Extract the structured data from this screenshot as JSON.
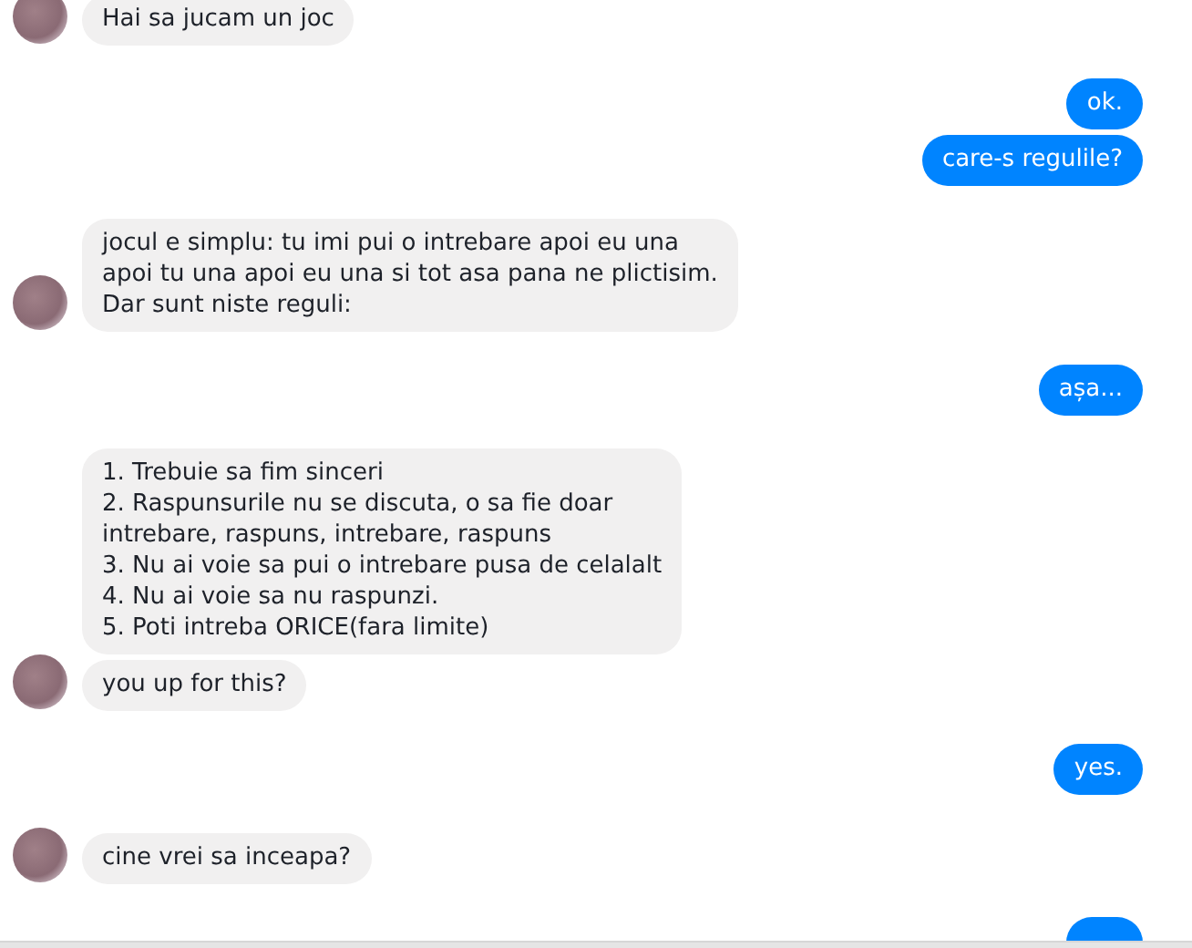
{
  "conversation": [
    {
      "outgoing": false,
      "messages": [
        {
          "kind": "text",
          "text": "Hai sa jucam un joc"
        }
      ]
    },
    {
      "outgoing": true,
      "messages": [
        {
          "kind": "text",
          "text": "ok."
        },
        {
          "kind": "text",
          "text": "care-s regulile?"
        }
      ]
    },
    {
      "outgoing": false,
      "messages": [
        {
          "kind": "text",
          "text": "jocul e simplu: tu imi pui o intrebare apoi eu una\napoi tu una apoi eu una si tot asa pana ne plictisim.\nDar sunt niste reguli:"
        }
      ]
    },
    {
      "outgoing": true,
      "messages": [
        {
          "kind": "text",
          "text": "așa..."
        }
      ]
    },
    {
      "outgoing": false,
      "messages": [
        {
          "kind": "text",
          "text": "1. Trebuie sa fim sinceri\n2. Raspunsurile nu se discuta, o sa fie doar\nintrebare, raspuns, intrebare, raspuns\n3. Nu ai voie sa pui o intrebare pusa de celalalt\n4. Nu ai voie sa nu raspunzi.\n5. Poti intreba ORICE(fara limite)"
        },
        {
          "kind": "text",
          "text": "you up for this?"
        }
      ]
    },
    {
      "outgoing": true,
      "messages": [
        {
          "kind": "text",
          "text": "yes."
        }
      ]
    },
    {
      "outgoing": false,
      "messages": [
        {
          "kind": "text",
          "text": "cine vrei sa inceapa?"
        }
      ]
    },
    {
      "outgoing": true,
      "messages": [
        {
          "kind": "partial"
        }
      ]
    }
  ]
}
